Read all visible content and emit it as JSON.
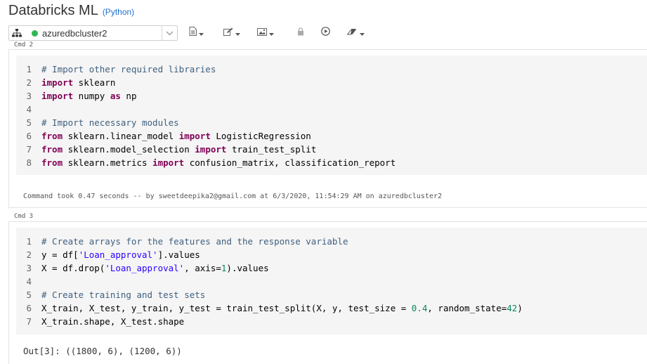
{
  "notebook": {
    "title": "Databricks ML",
    "language": "(Python)"
  },
  "toolbar": {
    "cluster_name": "azuredbcluster2",
    "cluster_status_color": "#2fb84f"
  },
  "cells": [
    {
      "label": "Cmd 2",
      "lines": [
        {
          "n": "1",
          "tokens": [
            {
              "t": "# Import other required libraries",
              "c": "cm"
            }
          ]
        },
        {
          "n": "2",
          "tokens": [
            {
              "t": "import",
              "c": "kw"
            },
            {
              "t": " sklearn",
              "c": "code"
            }
          ]
        },
        {
          "n": "3",
          "tokens": [
            {
              "t": "import",
              "c": "kw"
            },
            {
              "t": " numpy ",
              "c": "code"
            },
            {
              "t": "as",
              "c": "kw"
            },
            {
              "t": " np",
              "c": "code"
            }
          ]
        },
        {
          "n": "4",
          "tokens": []
        },
        {
          "n": "5",
          "tokens": [
            {
              "t": "# Import necessary modules",
              "c": "cm"
            }
          ]
        },
        {
          "n": "6",
          "tokens": [
            {
              "t": "from",
              "c": "kw"
            },
            {
              "t": " sklearn.linear_model ",
              "c": "code"
            },
            {
              "t": "import",
              "c": "kw"
            },
            {
              "t": " LogisticRegression",
              "c": "code"
            }
          ]
        },
        {
          "n": "7",
          "tokens": [
            {
              "t": "from",
              "c": "kw"
            },
            {
              "t": " sklearn.model_selection ",
              "c": "code"
            },
            {
              "t": "import",
              "c": "kw"
            },
            {
              "t": " train_test_split",
              "c": "code"
            }
          ]
        },
        {
          "n": "8",
          "tokens": [
            {
              "t": "from",
              "c": "kw"
            },
            {
              "t": " sklearn.metrics ",
              "c": "code"
            },
            {
              "t": "import",
              "c": "kw"
            },
            {
              "t": " confusion_matrix, classification_report",
              "c": "code"
            }
          ]
        }
      ],
      "result": "Command took 0.47 seconds -- by sweetdeepika2@gmail.com at 6/3/2020, 11:54:29 AM on azuredbcluster2"
    },
    {
      "label": "Cmd 3",
      "lines": [
        {
          "n": "1",
          "tokens": [
            {
              "t": "# Create arrays for the features and the response variable",
              "c": "cm"
            }
          ]
        },
        {
          "n": "2",
          "tokens": [
            {
              "t": "y = df[",
              "c": "code"
            },
            {
              "t": "'Loan_approval'",
              "c": "str"
            },
            {
              "t": "].values",
              "c": "code"
            }
          ]
        },
        {
          "n": "3",
          "tokens": [
            {
              "t": "X = df.drop(",
              "c": "code"
            },
            {
              "t": "'Loan_approval'",
              "c": "str"
            },
            {
              "t": ", axis=",
              "c": "code"
            },
            {
              "t": "1",
              "c": "num"
            },
            {
              "t": ").values",
              "c": "code"
            }
          ]
        },
        {
          "n": "4",
          "tokens": []
        },
        {
          "n": "5",
          "tokens": [
            {
              "t": "# Create training and test sets",
              "c": "cm"
            }
          ]
        },
        {
          "n": "6",
          "tokens": [
            {
              "t": "X_train, X_test, y_train, y_test = train_test_split(X, y, test_size = ",
              "c": "code"
            },
            {
              "t": "0.4",
              "c": "num"
            },
            {
              "t": ", random_state=",
              "c": "code"
            },
            {
              "t": "42",
              "c": "num"
            },
            {
              "t": ")",
              "c": "code"
            }
          ]
        },
        {
          "n": "7",
          "tokens": [
            {
              "t": "X_train.shape, X_test.shape",
              "c": "code"
            }
          ]
        }
      ],
      "output": "Out[3]: ((1800, 6), (1200, 6))"
    }
  ]
}
